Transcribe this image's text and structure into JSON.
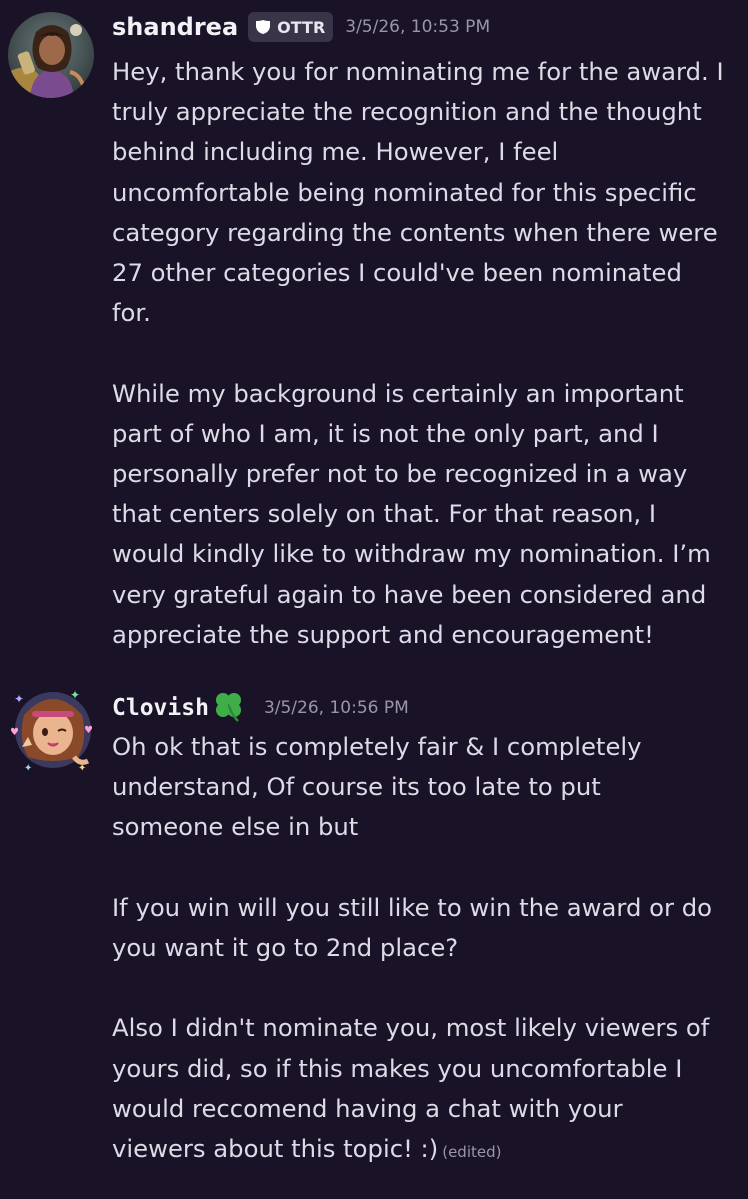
{
  "messages": [
    {
      "username": "shandrea",
      "tag": "OTTR",
      "tag_icon": "shield-icon",
      "timestamp": "3/5/26, 10:53 PM",
      "lines": [
        "Hey, thank you for nominating me for the award. I",
        "truly appreciate the recognition and the thought",
        "behind including me. However, I feel",
        "uncomfortable being nominated for this specific",
        "category regarding the contents when there were",
        "27 other categories I could've been nominated",
        "for.",
        "",
        "While my background is certainly an important",
        "part of who I am, it is not the only part, and I",
        "personally prefer not to be recognized in a way",
        "that centers solely on that. For that reason, I",
        "would kindly like to withdraw my nomination. I’m",
        "very grateful again to have been considered and",
        "appreciate the support and encouragement!"
      ]
    },
    {
      "username": "Clovish",
      "username_emoji": "four-leaf-clover-icon",
      "timestamp": "3/5/26, 10:56 PM",
      "lines": [
        "Oh ok that is completely fair & I completely",
        "understand, Of course its too late to put",
        "someone else in but",
        "",
        "If you win will you still like to win the award or do",
        "you want it go to 2nd place?",
        "",
        "Also I didn't nominate you, most likely viewers of",
        "yours did, so if this makes you uncomfortable I",
        "would reccomend having a chat with your",
        "viewers about this topic! :)"
      ],
      "edited_label": "(edited)"
    }
  ],
  "colors": {
    "background": "#1a1327",
    "username": "#f2f2f6",
    "body_text": "#dddbe6",
    "timestamp": "#9a96a8",
    "tag_bg": "#3a3448",
    "clover": "#3fae49"
  }
}
